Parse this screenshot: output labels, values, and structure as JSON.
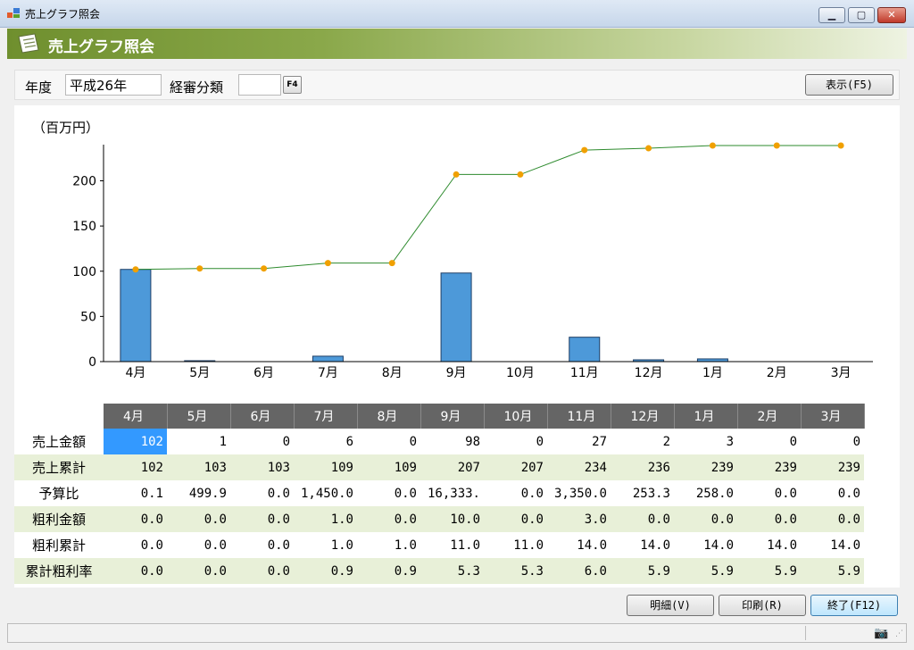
{
  "window": {
    "title": "売上グラフ照会",
    "min_glyph": "▁",
    "max_glyph": "▢",
    "close_glyph": "✕"
  },
  "header": {
    "title": "売上グラフ照会"
  },
  "filter": {
    "year_label": "年度",
    "year_value": "平成26年",
    "category_label": "経審分類",
    "category_value": "",
    "f4_label": "F4",
    "show_label": "表示(F5)"
  },
  "chart_data": {
    "type": "bar",
    "ylabel": "（百万円）",
    "ylim": [
      0,
      240
    ],
    "yticks": [
      0,
      50,
      100,
      150,
      200
    ],
    "categories": [
      "4月",
      "5月",
      "6月",
      "7月",
      "8月",
      "9月",
      "10月",
      "11月",
      "12月",
      "1月",
      "2月",
      "3月"
    ],
    "series": [
      {
        "type": "bar",
        "values": [
          102,
          1,
          0,
          6,
          0,
          98,
          0,
          27,
          2,
          3,
          0,
          0
        ],
        "color": "#4d99d9"
      },
      {
        "type": "line",
        "values": [
          102,
          103,
          103,
          109,
          109,
          207,
          207,
          234,
          236,
          239,
          239,
          239
        ],
        "color": "#2e8b2e",
        "marker_color": "#f0a000"
      }
    ]
  },
  "table": {
    "months": [
      "4月",
      "5月",
      "6月",
      "7月",
      "8月",
      "9月",
      "10月",
      "11月",
      "12月",
      "1月",
      "2月",
      "3月"
    ],
    "rows": [
      {
        "label": "売上金額",
        "values": [
          "102",
          "1",
          "0",
          "6",
          "0",
          "98",
          "0",
          "27",
          "2",
          "3",
          "0",
          "0"
        ]
      },
      {
        "label": "売上累計",
        "values": [
          "102",
          "103",
          "103",
          "109",
          "109",
          "207",
          "207",
          "234",
          "236",
          "239",
          "239",
          "239"
        ]
      },
      {
        "label": "予算比",
        "values": [
          "0.1",
          "499.9",
          "0.0",
          "1,450.0",
          "0.0",
          "16,333.",
          "0.0",
          "3,350.0",
          "253.3",
          "258.0",
          "0.0",
          "0.0"
        ]
      },
      {
        "label": "粗利金額",
        "values": [
          "0.0",
          "0.0",
          "0.0",
          "1.0",
          "0.0",
          "10.0",
          "0.0",
          "3.0",
          "0.0",
          "0.0",
          "0.0",
          "0.0"
        ]
      },
      {
        "label": "粗利累計",
        "values": [
          "0.0",
          "0.0",
          "0.0",
          "1.0",
          "1.0",
          "11.0",
          "11.0",
          "14.0",
          "14.0",
          "14.0",
          "14.0",
          "14.0"
        ]
      },
      {
        "label": "累計粗利率",
        "values": [
          "0.0",
          "0.0",
          "0.0",
          "0.9",
          "0.9",
          "5.3",
          "5.3",
          "6.0",
          "5.9",
          "5.9",
          "5.9",
          "5.9"
        ]
      }
    ]
  },
  "buttons": {
    "detail": "明細(V)",
    "print": "印刷(R)",
    "exit": "終了(F12)"
  },
  "statusbar": {
    "camera_glyph": "📷",
    "grip_glyph": "⋰"
  }
}
